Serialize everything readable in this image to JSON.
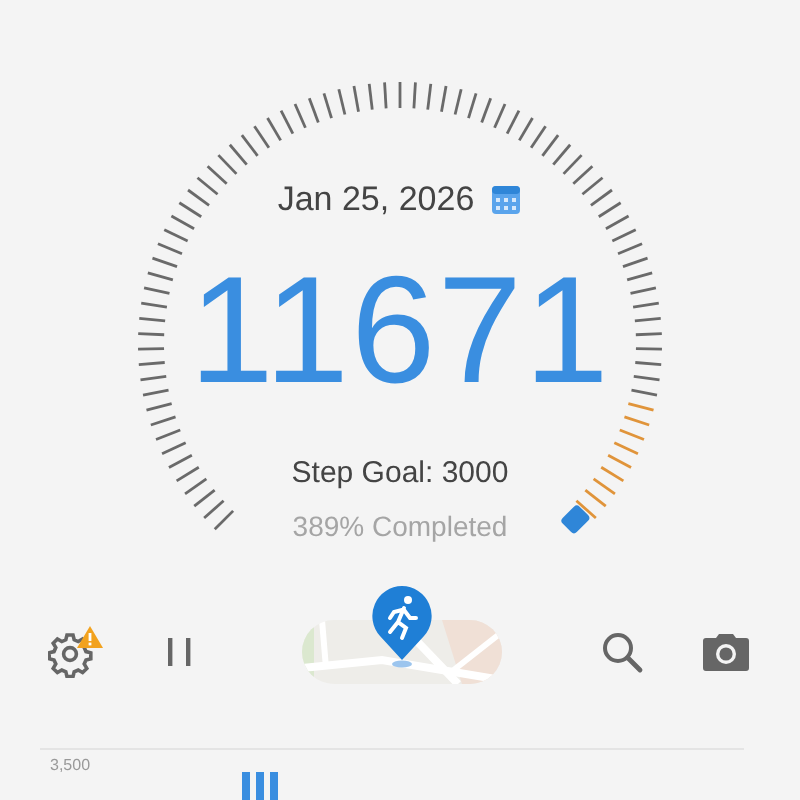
{
  "date": "Jan 25, 2026",
  "steps": "11671",
  "goal": "Step Goal: 3000",
  "completed": "389% Completed",
  "toolbar": {
    "settings_warning": true
  },
  "chart": {
    "top_label": "3,500"
  }
}
